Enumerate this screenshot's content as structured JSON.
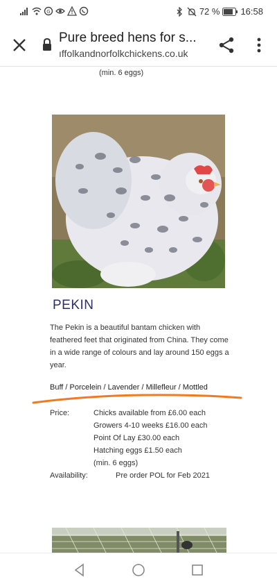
{
  "status": {
    "battery_percent": "72 %",
    "time": "16:58",
    "icons": [
      "signal-icon",
      "wifi-icon",
      "notification-icon",
      "eye-icon",
      "warning-icon",
      "whatsapp-icon",
      "bluetooth-icon",
      "mute-icon",
      "battery-icon"
    ]
  },
  "browser": {
    "title": "Pure breed hens for s...",
    "url": "ıffolkandnorfolkchickens.co.uk",
    "icons": [
      "close-icon",
      "lock-icon",
      "share-icon",
      "more-vert-icon"
    ]
  },
  "content": {
    "min_eggs_top": "(min. 6 eggs)",
    "breed": {
      "title": "PEKIN",
      "description": "The Pekin is a beautiful bantam chicken with feathered feet that originated from China. They come in a wide range of colours and lay around 150 eggs a year.",
      "colours": "Buff / Porcelein / Lavender / Millefleur / Mottled",
      "price_label": "Price:",
      "prices": [
        "Chicks available from £6.00 each",
        "Growers 4-10 weeks £16.00 each",
        "Point Of Lay £30.00 each",
        "Hatching eggs £1.50 each",
        "(min. 6 eggs)"
      ],
      "availability_label": "Availability:",
      "availability_value": "Pre order POL for Feb 2021"
    }
  },
  "colors": {
    "title_color": "#2c2f6a",
    "underline_color": "#f07a22"
  },
  "navbar": {
    "icons": [
      "back-triangle-icon",
      "home-circle-icon",
      "recents-square-icon"
    ]
  }
}
